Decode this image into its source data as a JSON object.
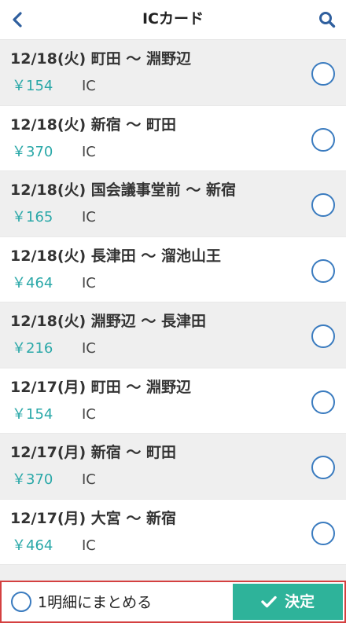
{
  "header": {
    "title": "ICカード",
    "back_icon": "chevron-left-icon",
    "search_icon": "search-icon"
  },
  "transactions": [
    {
      "title": "12/18(火) 町田 〜 淵野辺",
      "amount": "￥154",
      "type": "IC"
    },
    {
      "title": "12/18(火) 新宿 〜 町田",
      "amount": "￥370",
      "type": "IC"
    },
    {
      "title": "12/18(火) 国会議事堂前 〜 新宿",
      "amount": "￥165",
      "type": "IC"
    },
    {
      "title": "12/18(火) 長津田 〜 溜池山王",
      "amount": "￥464",
      "type": "IC"
    },
    {
      "title": "12/18(火) 淵野辺 〜 長津田",
      "amount": "￥216",
      "type": "IC"
    },
    {
      "title": "12/17(月) 町田 〜 淵野辺",
      "amount": "￥154",
      "type": "IC"
    },
    {
      "title": "12/17(月) 新宿 〜 町田",
      "amount": "￥370",
      "type": "IC"
    },
    {
      "title": "12/17(月) 大宮 〜 新宿",
      "amount": "￥464",
      "type": "IC"
    }
  ],
  "footer": {
    "merge_label": "1明細にまとめる",
    "confirm_label": "決定"
  },
  "colors": {
    "accent_teal": "#2eb39a",
    "amount_teal": "#2aa8a8",
    "radio_blue": "#3a7bbf",
    "highlight_red": "#d44040"
  }
}
